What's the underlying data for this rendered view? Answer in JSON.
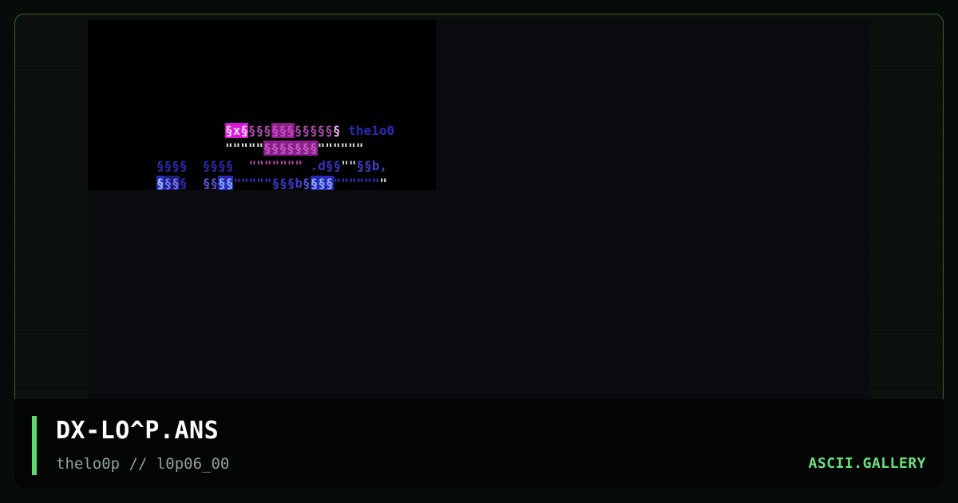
{
  "artwork": {
    "lines": [
      [
        {
          "text": "§x§",
          "color": "#ffd6ff",
          "bg": "#d818d8"
        },
        {
          "text": "§§§",
          "color": "#b24ab0",
          "bg": ""
        },
        {
          "text": "§§§",
          "color": "#c44ac4",
          "bg": "#8a1f8a"
        },
        {
          "text": "§§§§§",
          "color": "#b24ab0",
          "bg": ""
        },
        {
          "text": "§",
          "color": "#f0b6f0",
          "bg": ""
        },
        {
          "text": " the1o0",
          "color": "#2a2ab8",
          "bg": ""
        }
      ],
      [
        {
          "text": "\"\"\"\"\"",
          "color": "#e0e0e0",
          "bg": ""
        },
        {
          "text": "§§§§§§§",
          "color": "#c45ac4",
          "bg": "#8a1f8a"
        },
        {
          "text": "\"\"\"\"\"\"",
          "color": "#e0e0e0",
          "bg": ""
        }
      ],
      [
        {
          "text": "§§§§  §§§§  ",
          "color": "#2a2ab8",
          "bg": ""
        },
        {
          "text": "\"\"\"\"\"\"\"",
          "color": "#b24ab0",
          "bg": ""
        },
        {
          "text": " .d§§",
          "color": "#3434c4",
          "bg": ""
        },
        {
          "text": "\"\"",
          "color": "#c8c8c8",
          "bg": ""
        },
        {
          "text": "§§b,",
          "color": "#4040d0",
          "bg": ""
        }
      ],
      [
        {
          "text": "§",
          "color": "#a0c8ff",
          "bg": "#2a2ab8"
        },
        {
          "text": "§§",
          "color": "#7878ff",
          "bg": "#1e1e7a"
        },
        {
          "text": "§  ",
          "color": "#2a2ab8",
          "bg": ""
        },
        {
          "text": "§§",
          "color": "#5858e0",
          "bg": ""
        },
        {
          "text": "§§",
          "color": "#8ab0ff",
          "bg": "#2a2ab8"
        },
        {
          "text": "\"\"\"\"\"",
          "color": "#3434c4",
          "bg": ""
        },
        {
          "text": "§§§b",
          "color": "#3a3ac8",
          "bg": ""
        },
        {
          "text": "§",
          "color": "#5858e0",
          "bg": ""
        },
        {
          "text": "§§§",
          "color": "#8ab0ff",
          "bg": "#2a2ab8"
        },
        {
          "text": "\"\"\"\"\"\"",
          "color": "#3434c4",
          "bg": ""
        },
        {
          "text": "\"",
          "color": "#e0e0e0",
          "bg": ""
        }
      ]
    ]
  },
  "footer": {
    "title": "DX-LO^P.ANS",
    "subtitle": "thelo0p // l0p06_00",
    "brand": "ASCII.GALLERY"
  },
  "colors": {
    "accent": "#5bd96c",
    "frame_border": "#2f6a33"
  }
}
